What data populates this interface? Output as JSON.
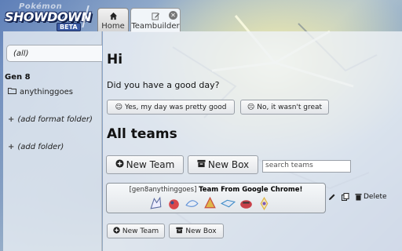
{
  "header": {
    "logo_top": "Pokémon",
    "logo_main": "SHOWDOWN",
    "logo_badge": "BETA",
    "tabs": [
      {
        "label": "Home",
        "icon": "home-icon"
      },
      {
        "label": "Teambuilder",
        "icon": "edit-icon",
        "active": true
      }
    ]
  },
  "sidebar": {
    "filter_all": "(all)",
    "gen_label": "Gen 8",
    "format_folder": "anythinggoes",
    "add_format_folder": "(add format folder)",
    "add_folder": "(add folder)"
  },
  "main": {
    "greeting_title": "Hi",
    "greeting_question": "Did you have a good day?",
    "yes_button": "Yes, my day was pretty good",
    "no_button": "No, it wasn't great",
    "all_teams_title": "All teams",
    "new_team_button": "New Team",
    "new_box_button": "New Box",
    "search_placeholder": "search teams",
    "team": {
      "format_tag": "[gen8anythinggoes]",
      "name": "Team From Google Chrome!",
      "sprite_colors": [
        "#6d7fb8",
        "#d9464b",
        "#5d8fd6",
        "#c94f3f",
        "#3d8bc8",
        "#c8414a",
        "#e0b74a"
      ]
    },
    "delete_label": "Delete",
    "bottom_new_team": "New Team",
    "bottom_new_box": "New Box"
  }
}
